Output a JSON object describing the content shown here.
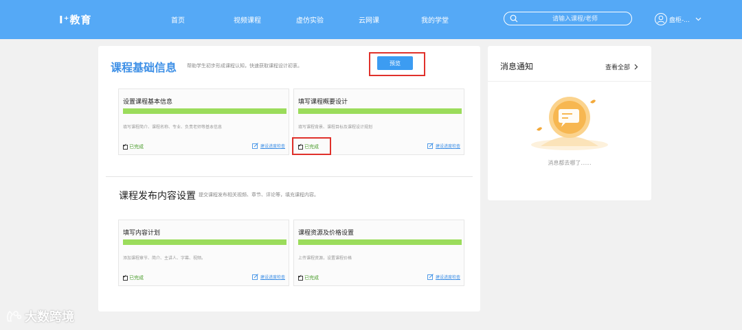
{
  "header": {
    "logo": "I⁺教育",
    "nav": [
      "首页",
      "视频课程",
      "虚仿实验",
      "云网课",
      "我的学堂"
    ],
    "search_placeholder": "请输入课程/老师",
    "user_name": "盘柜-..."
  },
  "main": {
    "section1": {
      "title": "课程基础信息",
      "subtitle": "帮助学生初步形成课程认知，快速获取课程设计初衷。",
      "preview_label": "预览",
      "tasks": [
        {
          "title": "设置课程基本信息",
          "desc": "填写课程简介、课程名称、专业、负责老师等基本信息",
          "status": "已完成",
          "link": "建设进度检查",
          "progress": 1.0
        },
        {
          "title": "填写课程概要设计",
          "desc": "填写课程背景、课程目标及课程设计规划",
          "status": "已完成",
          "link": "建设进度检查",
          "progress": 1.0
        }
      ]
    },
    "section2": {
      "title": "课程发布内容设置",
      "subtitle": "提交课程发布相关视频、章节、评论等，填充课程内容。",
      "tasks": [
        {
          "title": "填写内容计划",
          "desc": "添加课程章节、简介、主讲人、字幕、视频。",
          "status": "已完成",
          "link": "建设进度检查",
          "progress": 1.0
        },
        {
          "title": "课程资源及价格设置",
          "desc": "上传课程资源，设置课程价格",
          "status": "已完成",
          "link": "建设进度检查",
          "progress": 1.0
        }
      ]
    }
  },
  "sidebar": {
    "title": "消息通知",
    "more_label": "查看全部",
    "empty_text": "消息都去哪了......"
  },
  "watermark": "大数跨境",
  "colors": {
    "header_bg": "#55a9f6",
    "accent": "#3d8fe6",
    "progress": "#9bdc5b",
    "done": "#4a9d2b",
    "highlight": "#e0302a"
  }
}
